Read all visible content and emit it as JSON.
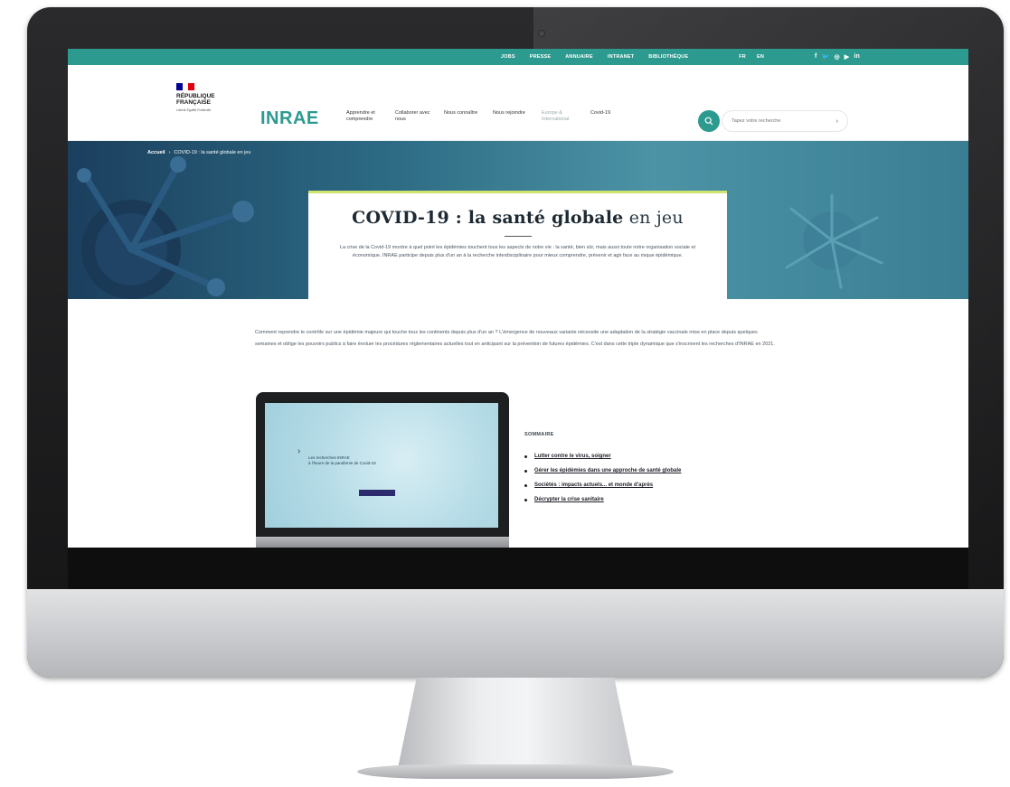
{
  "topbar": {
    "links": [
      "JOBS",
      "PRESSE",
      "ANNUAIRE",
      "INTRANET",
      "BIBLIOTHÈQUE"
    ],
    "langs": [
      "FR",
      "EN"
    ],
    "social_icons": [
      "facebook-icon",
      "twitter-icon",
      "instagram-icon",
      "youtube-icon",
      "linkedin-icon"
    ]
  },
  "header": {
    "rf_title_line1": "RÉPUBLIQUE",
    "rf_title_line2": "FRANÇAISE",
    "rf_motto": "Liberté Égalité Fraternité",
    "logo": "INRAE",
    "nav": [
      {
        "label": "Apprendre et comprendre"
      },
      {
        "label": "Collaborer avec nous"
      },
      {
        "label": "Nous connaître"
      },
      {
        "label": "Nous rejoindre"
      },
      {
        "label": "Europe & International"
      },
      {
        "label": "Covid-19"
      }
    ],
    "search_placeholder": "Tapez votre recherche"
  },
  "hero": {
    "breadcrumb_home": "Accueil",
    "breadcrumb_current": "COVID-19 : la santé globale en jeu",
    "title_bold": "COVID-19 : la santé globale",
    "title_thin": " en jeu",
    "text": "La crise de la Covid-19 montre à quel point les épidémies touchent tous les aspects de notre vie : la santé, bien sûr, mais aussi toute notre organisation sociale et économique. INRAE participe depuis plus d'un an à la recherche interdisciplinaire pour mieux comprendre, prévenir et agir face au risque épidémique."
  },
  "intro": "Comment reprendre le contrôle sur une épidémie majeure qui touche tous les continents depuis plus d'un an ? L'émergence de nouveaux variants nécessite une adaptation de la stratégie vaccinale mise en place depuis quelques semaines et oblige les pouvoirs publics à faire évoluer les procédures réglementaires actuelles tout en anticipant sur la prévention de futures épidémies. C'est dans cette triple dynamique que s'inscrivent les recherches d'INRAE en 2021.",
  "laptop": {
    "line1": "Les recherches INRAE",
    "line2": "à l'heure de la pandémie de Covid-19"
  },
  "sommaire": {
    "label": "SOMMAIRE",
    "items": [
      "Lutter contre le virus, soigner",
      "Gérer les épidémies dans une approche de santé globale",
      "Sociétés : impacts actuels... et monde d'après",
      "Décrypter la crise sanitaire"
    ]
  },
  "colors": {
    "accent": "#2c9a8f",
    "hero_dark": "#1b3f5e",
    "hero_light": "#4c93a6",
    "card_rule": "#cfe36f",
    "flag_blue": "#000091",
    "flag_red": "#e1000f"
  }
}
